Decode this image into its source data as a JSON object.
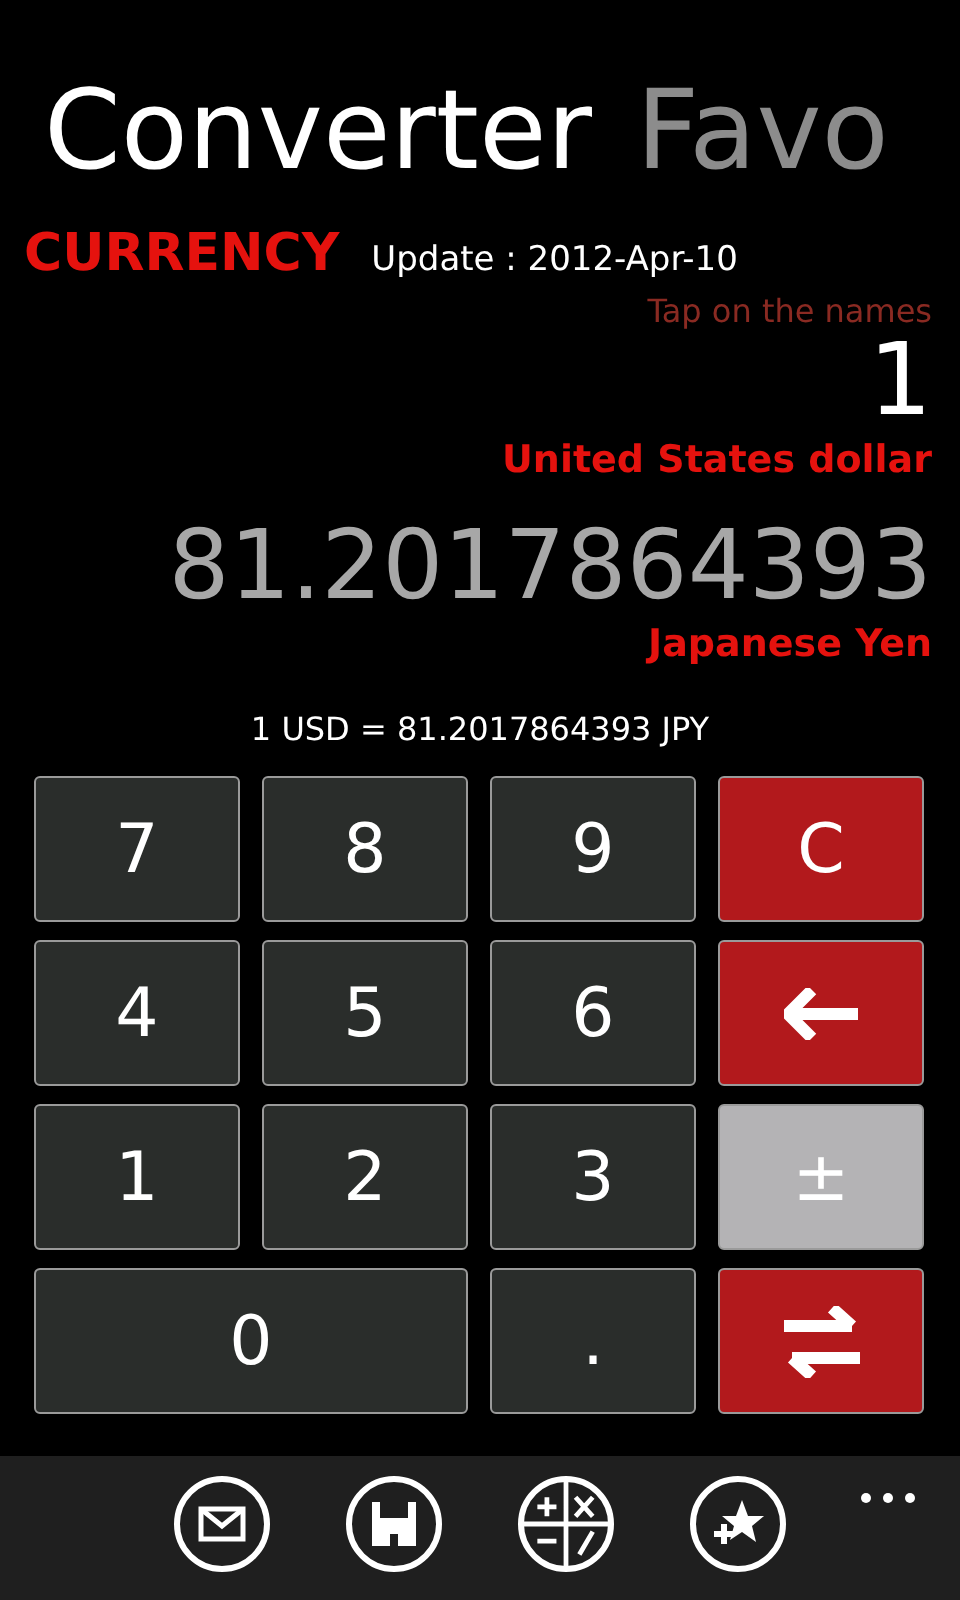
{
  "pivot": [
    {
      "label": "Converter",
      "selected": true
    },
    {
      "label": "Favo",
      "selected": false
    }
  ],
  "category": "CURRENCY",
  "update": "Update : 2012-Apr-10",
  "hint": "Tap on the names",
  "from": {
    "amount": "1",
    "name": "United States dollar"
  },
  "to": {
    "amount": "81.2017864393",
    "name": "Japanese Yen"
  },
  "rate": "1 USD = 81.2017864393 JPY",
  "keys": [
    {
      "kind": "digit",
      "label": "7"
    },
    {
      "kind": "digit",
      "label": "8"
    },
    {
      "kind": "digit",
      "label": "9"
    },
    {
      "kind": "clear",
      "label": "C"
    },
    {
      "kind": "digit",
      "label": "4"
    },
    {
      "kind": "digit",
      "label": "5"
    },
    {
      "kind": "digit",
      "label": "6"
    },
    {
      "kind": "backspace"
    },
    {
      "kind": "digit",
      "label": "1"
    },
    {
      "kind": "digit",
      "label": "2"
    },
    {
      "kind": "digit",
      "label": "3"
    },
    {
      "kind": "sign",
      "label": "±"
    },
    {
      "kind": "wide",
      "label": "0"
    },
    {
      "kind": "digit",
      "label": "."
    },
    {
      "kind": "swap"
    }
  ],
  "app_bar": [
    {
      "kind": "mail"
    },
    {
      "kind": "save"
    },
    {
      "kind": "calc"
    },
    {
      "kind": "favorite"
    }
  ]
}
